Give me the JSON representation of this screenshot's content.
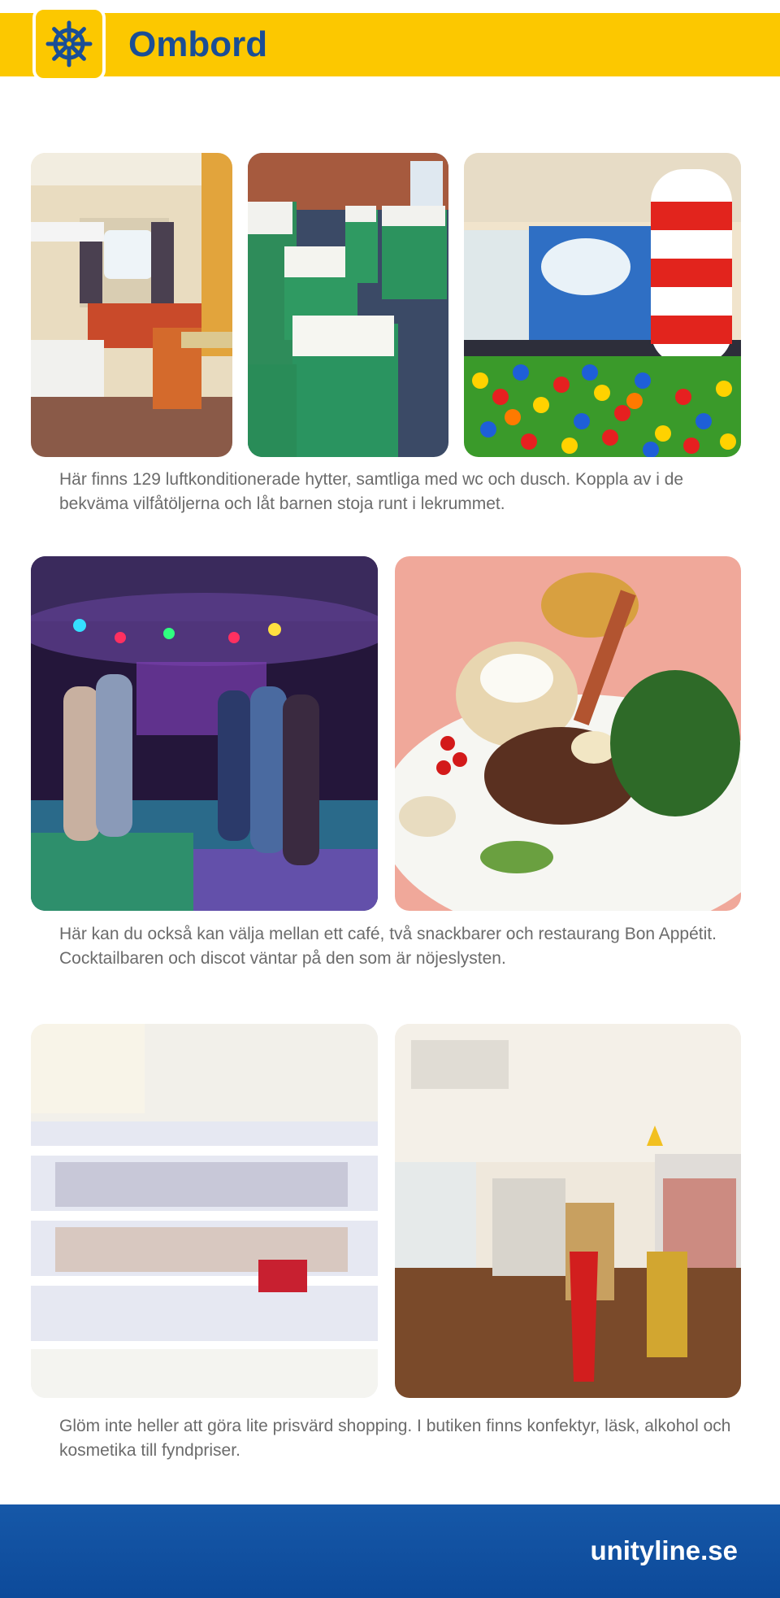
{
  "header": {
    "title": "Ombord",
    "logo_icon": "ship-wheel-icon",
    "background_color": "#fcc800",
    "title_color": "#1a4e96"
  },
  "sections": [
    {
      "photos": [
        "cabin-photo",
        "reclining-seats-photo",
        "playroom-photo"
      ],
      "caption": "Här finns 129 luftkonditionerade hytter, samtliga med wc och dusch. Koppla av i de bekväma vilfåtöljerna och låt barnen stoja runt i lekrummet."
    },
    {
      "photos": [
        "disco-photo",
        "steak-dish-photo"
      ],
      "caption": "Här kan du också kan välja mellan ett café, två snackbarer och restaurang Bon Appétit. Cocktailbaren och discot väntar på den som är nöjeslysten."
    },
    {
      "photos": [
        "cosmetics-shelves-photo",
        "shop-interior-photo"
      ],
      "caption": "Glöm inte heller att göra lite prisvärd shopping. I butiken finns konfektyr, läsk, alkohol och kosmetika till fyndpriser."
    }
  ],
  "footer": {
    "url": "unityline.se",
    "background_color": "#1658a8"
  }
}
